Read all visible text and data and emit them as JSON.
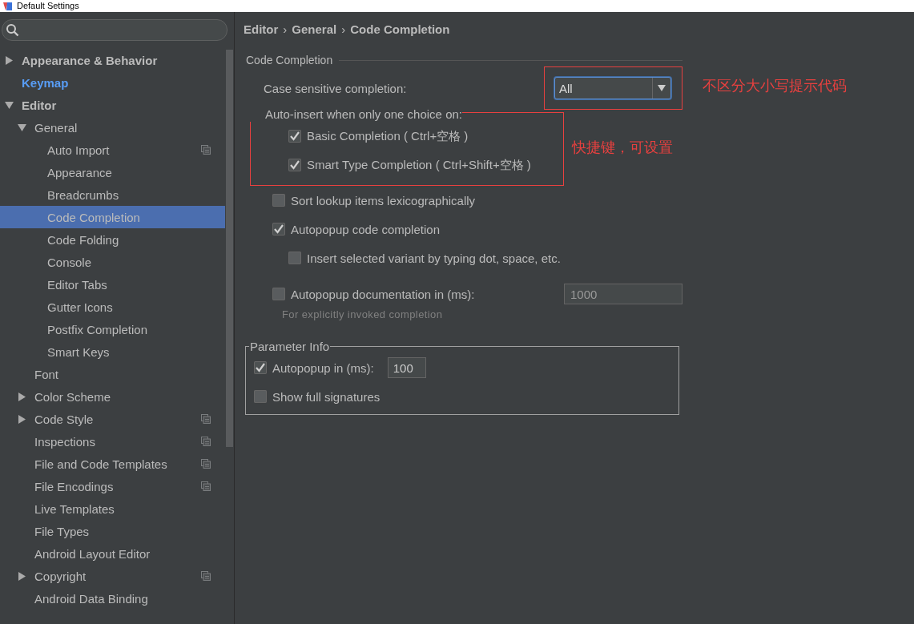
{
  "window": {
    "title": "Default Settings"
  },
  "sidebar": {
    "items": [
      {
        "label": "Appearance & Behavior",
        "selected": false,
        "expanded": false,
        "modified": false,
        "project_scoped": false
      },
      {
        "label": "Keymap",
        "selected": false,
        "modified": true,
        "project_scoped": false
      },
      {
        "label": "Editor",
        "selected": false,
        "expanded": true,
        "modified": false,
        "project_scoped": false,
        "children": [
          {
            "label": "General",
            "selected": false,
            "expanded": true,
            "project_scoped": false,
            "children": [
              {
                "label": "Auto Import",
                "selected": false,
                "project_scoped": true
              },
              {
                "label": "Appearance",
                "selected": false,
                "project_scoped": false
              },
              {
                "label": "Breadcrumbs",
                "selected": false,
                "project_scoped": false
              },
              {
                "label": "Code Completion",
                "selected": true,
                "project_scoped": false
              },
              {
                "label": "Code Folding",
                "selected": false,
                "project_scoped": false
              },
              {
                "label": "Console",
                "selected": false,
                "project_scoped": false
              },
              {
                "label": "Editor Tabs",
                "selected": false,
                "project_scoped": false
              },
              {
                "label": "Gutter Icons",
                "selected": false,
                "project_scoped": false
              },
              {
                "label": "Postfix Completion",
                "selected": false,
                "project_scoped": false
              },
              {
                "label": "Smart Keys",
                "selected": false,
                "project_scoped": false
              }
            ]
          },
          {
            "label": "Font",
            "selected": false,
            "project_scoped": false
          },
          {
            "label": "Color Scheme",
            "selected": false,
            "expanded": false,
            "project_scoped": false
          },
          {
            "label": "Code Style",
            "selected": false,
            "expanded": false,
            "project_scoped": true
          },
          {
            "label": "Inspections",
            "selected": false,
            "project_scoped": true
          },
          {
            "label": "File and Code Templates",
            "selected": false,
            "project_scoped": true
          },
          {
            "label": "File Encodings",
            "selected": false,
            "project_scoped": true
          },
          {
            "label": "Live Templates",
            "selected": false,
            "project_scoped": false
          },
          {
            "label": "File Types",
            "selected": false,
            "project_scoped": false
          },
          {
            "label": "Android Layout Editor",
            "selected": false,
            "project_scoped": false
          },
          {
            "label": "Copyright",
            "selected": false,
            "expanded": false,
            "project_scoped": true
          },
          {
            "label": "Android Data Binding",
            "selected": false,
            "project_scoped": false
          }
        ]
      }
    ]
  },
  "breadcrumb": [
    "Editor",
    "General",
    "Code Completion"
  ],
  "breadcrumb_separator": "›",
  "code_completion": {
    "title": "Code Completion",
    "case_sensitive": {
      "label": "Case sensitive completion:",
      "value": "All",
      "annotation": "不区分大小写提示代码"
    },
    "auto_insert": {
      "label": "Auto-insert when only one choice on:",
      "annotation": "快捷键，可设置",
      "options": [
        {
          "label": "Basic Completion ( Ctrl+空格 )",
          "checked": true
        },
        {
          "label": "Smart Type Completion ( Ctrl+Shift+空格 )",
          "checked": true
        }
      ]
    },
    "options": [
      {
        "label": "Sort lookup items lexicographically",
        "checked": false,
        "nested": false
      },
      {
        "label": "Autopopup code completion",
        "checked": true,
        "nested": false
      },
      {
        "label": "Insert selected variant by typing dot, space, etc.",
        "checked": false,
        "nested": true
      }
    ],
    "autopopup_documentation": {
      "label": "Autopopup documentation in (ms):",
      "checked": false,
      "value": "1000",
      "hint": "For explicitly invoked completion"
    }
  },
  "parameter_info": {
    "title": "Parameter Info",
    "autopopup": {
      "label": "Autopopup in (ms):",
      "checked": true,
      "value": "100"
    },
    "show_full_signatures": {
      "label": "Show full signatures",
      "checked": false
    }
  }
}
